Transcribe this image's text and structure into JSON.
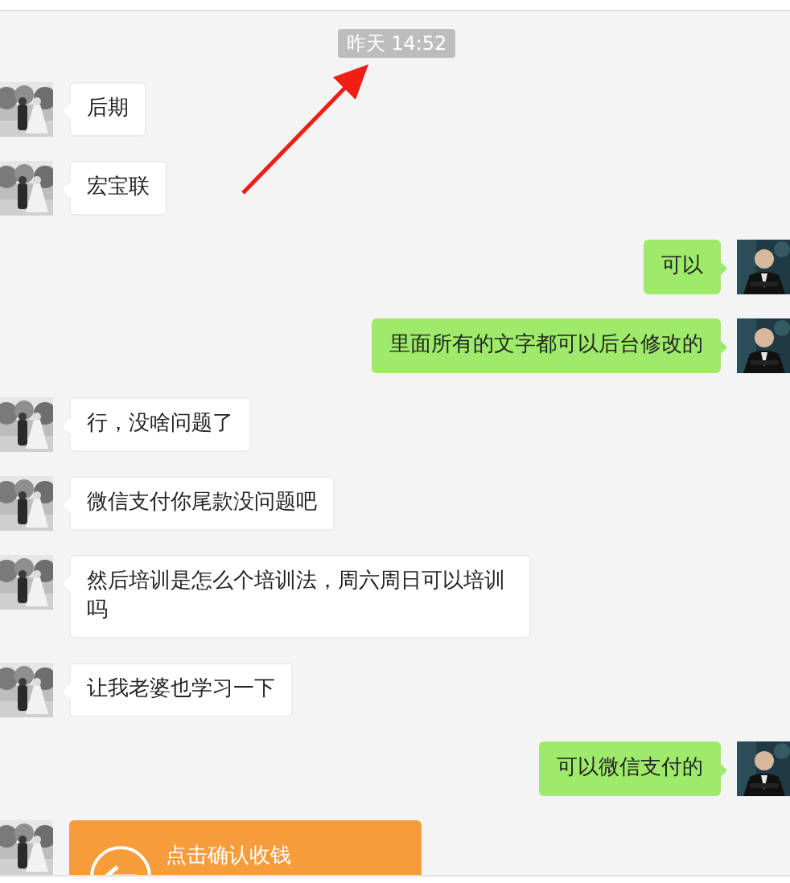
{
  "timestamp": "昨天 14:52",
  "messages": [
    {
      "kind": "text",
      "outgoing": false,
      "text": "后期"
    },
    {
      "kind": "text",
      "outgoing": false,
      "text": "宏宝联"
    },
    {
      "kind": "text",
      "outgoing": true,
      "text": "可以"
    },
    {
      "kind": "text",
      "outgoing": true,
      "text": "里面所有的文字都可以后台修改的"
    },
    {
      "kind": "text",
      "outgoing": false,
      "text": "行，没啥问题了"
    },
    {
      "kind": "text",
      "outgoing": false,
      "text": "微信支付你尾款没问题吧"
    },
    {
      "kind": "text",
      "outgoing": false,
      "text": "然后培训是怎么个培训法，周六周日可以培训吗"
    },
    {
      "kind": "text",
      "outgoing": false,
      "text": "让我老婆也学习一下"
    },
    {
      "kind": "text",
      "outgoing": true,
      "text": "可以微信支付的"
    },
    {
      "kind": "transfer",
      "outgoing": false,
      "text": "点击确认收钱"
    }
  ]
}
